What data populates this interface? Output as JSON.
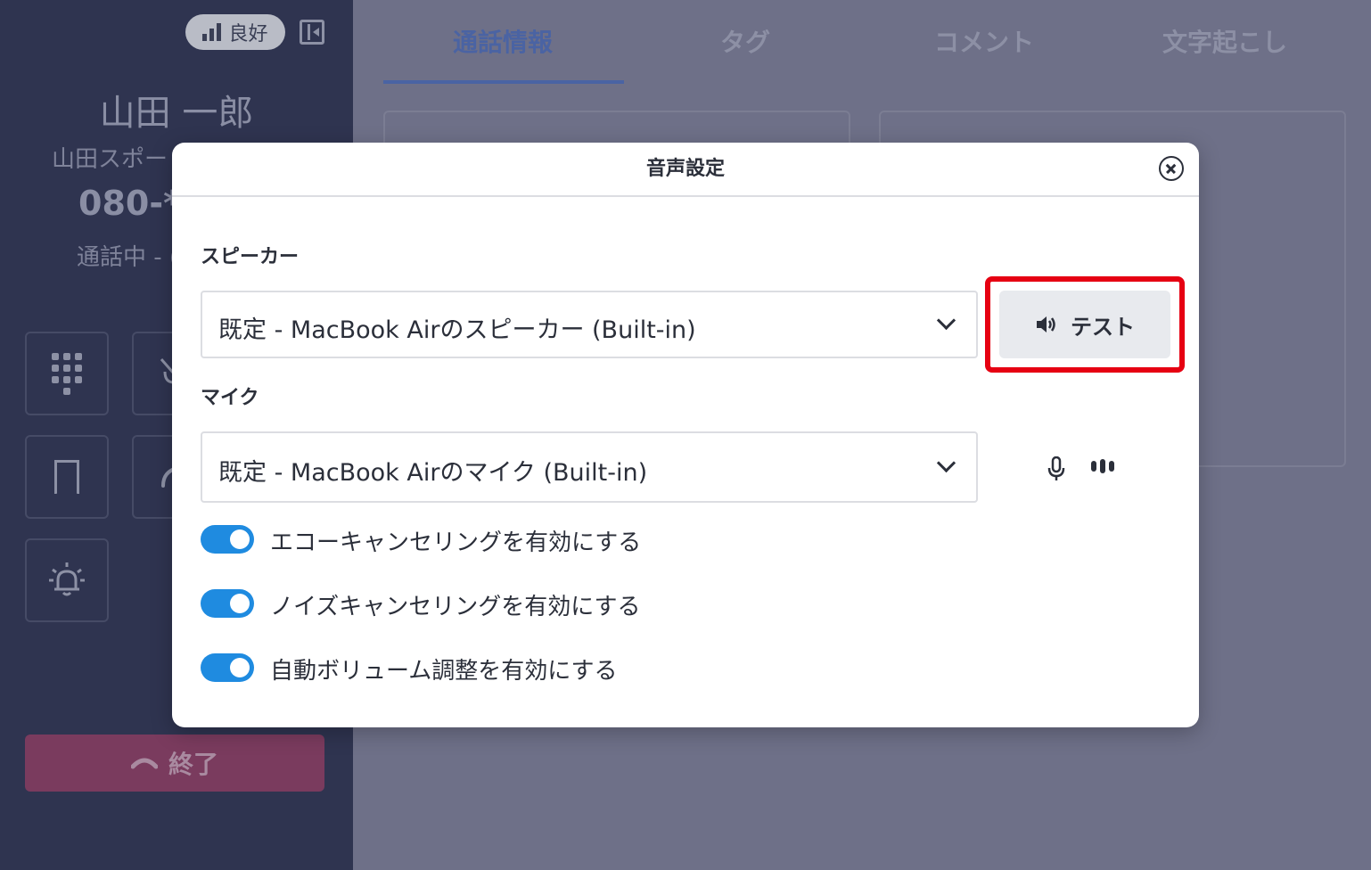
{
  "sidebar": {
    "signal_label": "良好",
    "caller_name": "山田 一郎",
    "caller_company": "山田スポー",
    "caller_phone": "080-**",
    "call_status": "通話中 - (",
    "end_call_label": "終了"
  },
  "tabs": [
    {
      "label": "通話情報",
      "active": true
    },
    {
      "label": "タグ",
      "active": false
    },
    {
      "label": "コメント",
      "active": false
    },
    {
      "label": "文字起こし",
      "active": false
    }
  ],
  "modal": {
    "title": "音声設定",
    "speaker": {
      "label": "スピーカー",
      "selected": "既定 - MacBook Airのスピーカー (Built-in)",
      "test_label": "テスト"
    },
    "mic": {
      "label": "マイク",
      "selected": "既定 - MacBook Airのマイク (Built-in)"
    },
    "toggles": [
      {
        "label": "エコーキャンセリングを有効にする",
        "on": true
      },
      {
        "label": "ノイズキャンセリングを有効にする",
        "on": true
      },
      {
        "label": "自動ボリューム調整を有効にする",
        "on": true
      }
    ]
  },
  "colors": {
    "accent": "#1f8be0",
    "highlight": "#e60012",
    "sidebar_bg": "#2f3450"
  }
}
